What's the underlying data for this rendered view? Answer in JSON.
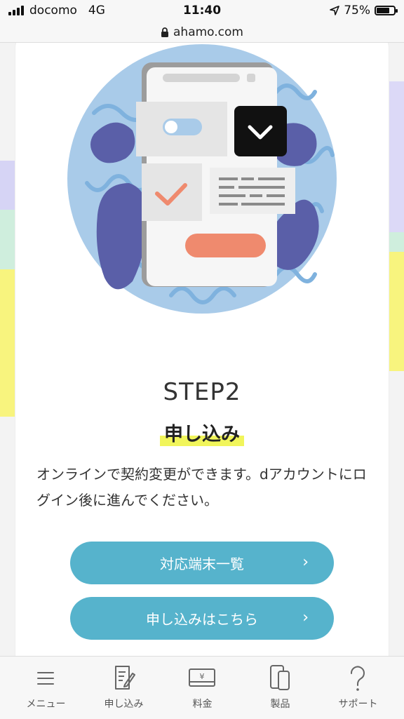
{
  "status": {
    "carrier": "docomo",
    "network": "4G",
    "time": "11:40",
    "battery": "75%",
    "battery_level": 0.75
  },
  "browser": {
    "url": "ahamo.com"
  },
  "colors": {
    "accent": "#56b3cc",
    "highlight": "#f1f55b",
    "illustration_blue": "#a9cbe9",
    "illustration_purple": "#5a5fa8",
    "illustration_orange": "#ef8a6e"
  },
  "step": {
    "label": "STEP2",
    "title": "申し込み",
    "description": "オンラインで契約変更ができます。dアカウントにログイン後に進んでください。",
    "buttons": [
      {
        "label": "対応端末一覧",
        "icon": "chevron-right-icon"
      },
      {
        "label": "申し込みはこちら",
        "icon": "chevron-right-icon"
      }
    ]
  },
  "tabs": [
    {
      "label": "メニュー",
      "icon": "menu-icon"
    },
    {
      "label": "申し込み",
      "icon": "application-form-icon"
    },
    {
      "label": "料金",
      "icon": "yen-price-icon"
    },
    {
      "label": "製品",
      "icon": "phones-icon"
    },
    {
      "label": "サポート",
      "icon": "question-icon"
    }
  ]
}
